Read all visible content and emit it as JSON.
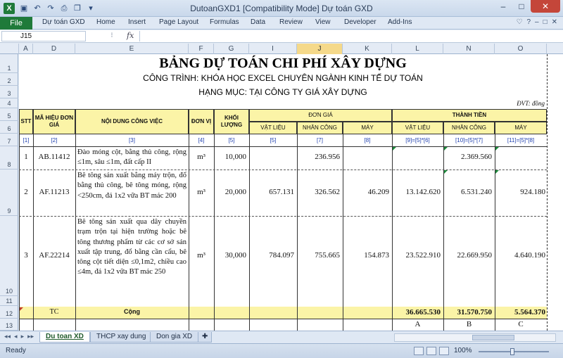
{
  "window": {
    "title": "DutoanGXD1  [Compatibility Mode]   Dự toán GXD",
    "app_letter": "X",
    "minimize": "–",
    "maximize": "□",
    "close": "✕"
  },
  "ribbon": {
    "file": "File",
    "tabs": [
      "Dự toán GXD",
      "Home",
      "Insert",
      "Page Layout",
      "Formulas",
      "Data",
      "Review",
      "View",
      "Developer",
      "Add-Ins"
    ],
    "right_icons": [
      "♡",
      "?",
      "–",
      "□",
      "✕"
    ]
  },
  "formula_bar": {
    "name_box": "J15",
    "fx": "fx",
    "value": ""
  },
  "columns": [
    "A",
    "D",
    "E",
    "F",
    "G",
    "I",
    "J",
    "K",
    "L",
    "N",
    "O"
  ],
  "selected_column": "J",
  "rows": [
    "1",
    "2",
    "3",
    "4",
    "5",
    "6",
    "7",
    "8",
    "9",
    "10",
    "11",
    "12",
    "13"
  ],
  "sheet": {
    "title": "BẢNG DỰ TOÁN CHI PHÍ XÂY DỰNG",
    "project": "CÔNG TRÌNH: KHÓA HỌC EXCEL CHUYÊN NGÀNH KINH TẾ DỰ TOÁN",
    "category": "HẠNG MỤC: TẠI CÔNG TY GIÁ XÂY DỰNG",
    "unit_note": "ĐVT: đồng",
    "headers": {
      "stt": "STT",
      "code": "MÃ HIỆU ĐƠN GIÁ",
      "work": "NỘI DUNG CÔNG VIỆC",
      "unit": "ĐƠN VỊ",
      "qty": "KHỐI LƯỢNG",
      "unit_price": "ĐƠN GIÁ",
      "total": "THÀNH TIỀN",
      "material": "VẬT LIỆU",
      "labor": "NHÂN CÔNG",
      "machine": "MÁY",
      "t_material": "VẬT LIỆU",
      "t_labor": "NHÂN CÔNG",
      "t_machine": "MÁY"
    },
    "index_row": [
      "[1]",
      "[2]",
      "[3]",
      "[4]",
      "[5]",
      "[5]",
      "[7]",
      "[8]",
      "[9]=[5]*[6]",
      "[10]=[5]*[7]",
      "[11]=[5]*[8]"
    ],
    "items": [
      {
        "stt": "1",
        "code": "AB.11412",
        "work": "Đào móng cột, bằng thủ công, rộng ≤1m, sâu ≤1m, đất cấp II",
        "unit": "m³",
        "qty": "10,000",
        "material": "",
        "labor": "236.956",
        "machine": "",
        "t_material": "",
        "t_labor": "2.369.560",
        "t_machine": ""
      },
      {
        "stt": "2",
        "code": "AF.11213",
        "work": "Bê tông sản xuất bằng máy trộn, đổ bằng thủ công, bê tông móng, rộng <250cm, đá 1x2 vữa BT mác 200",
        "unit": "m³",
        "qty": "20,000",
        "material": "657.131",
        "labor": "326.562",
        "machine": "46.209",
        "t_material": "13.142.620",
        "t_labor": "6.531.240",
        "t_machine": "924.180"
      },
      {
        "stt": "3",
        "code": "AF.22214",
        "work": "Bê tông sản xuất qua dây chuyền trạm trộn tại hiện trường hoặc bê tông thương phẩm từ các cơ sở sản xuất tập trung, đổ bằng cần cẩu, bê tông cột tiết diện ≤0,1m2, chiều cao ≤4m, đá 1x2 vữa BT mác 250",
        "unit": "m³",
        "qty": "30,000",
        "material": "784.097",
        "labor": "755.665",
        "machine": "154.873",
        "t_material": "23.522.910",
        "t_labor": "22.669.950",
        "t_machine": "4.640.190"
      }
    ],
    "total": {
      "stt": "",
      "code": "TC",
      "label": "Cộng",
      "t_material": "36.665.530",
      "t_labor": "31.570.750",
      "t_machine": "5.564.370"
    },
    "letters": [
      "A",
      "B",
      "C"
    ]
  },
  "sheet_tabs": [
    "Du toan XD",
    "THCP xay dung",
    "Don gia XD"
  ],
  "active_sheet": "Du toan XD",
  "nav": [
    "◂◂",
    "◂",
    "▸",
    "▸▸"
  ],
  "status": {
    "ready": "Ready",
    "zoom": "100%",
    "minus": "–",
    "plus": "+"
  }
}
